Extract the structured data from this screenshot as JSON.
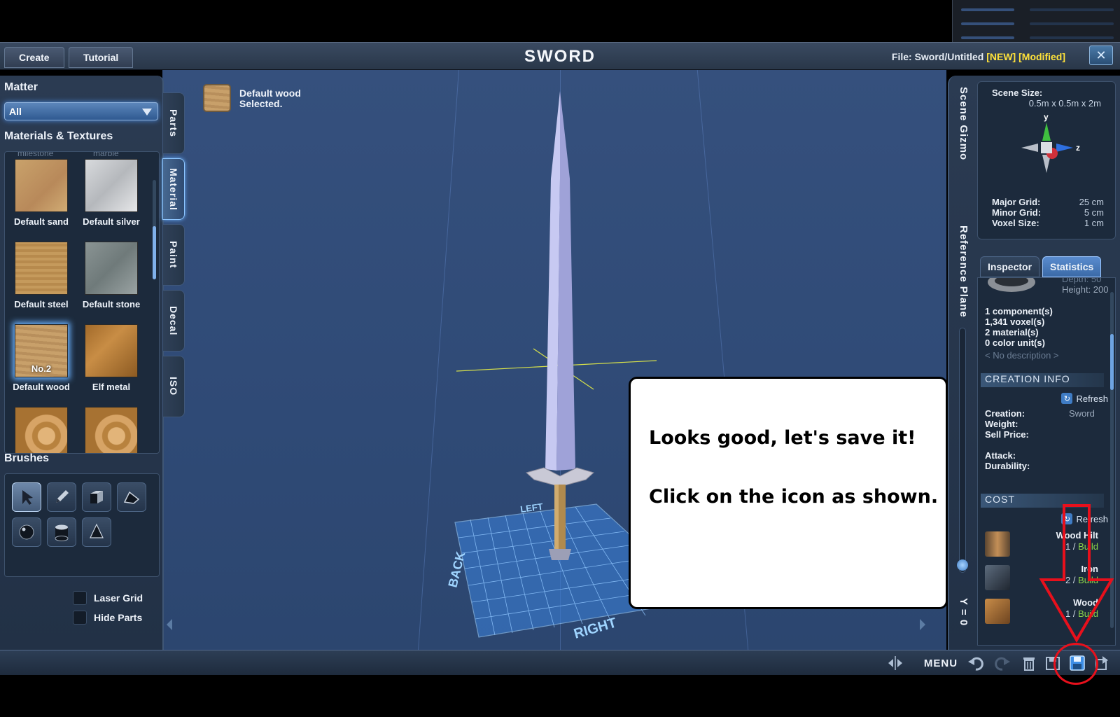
{
  "window": {
    "create_tab": "Create",
    "tutorial_tab": "Tutorial",
    "title": "SWORD",
    "file_label": "File:",
    "file_name": "Sword/Untitled",
    "tag_new": "[NEW]",
    "tag_modified": "[Modified]",
    "close_glyph": "✕"
  },
  "left_panel": {
    "matter_heading": "Matter",
    "matter_select": "All",
    "materials_heading": "Materials & Textures",
    "cutoff_labels": [
      "milestone",
      "marble"
    ],
    "materials": [
      {
        "label": "Default sand"
      },
      {
        "label": "Default silver"
      },
      {
        "label": "Default steel"
      },
      {
        "label": "Default stone"
      },
      {
        "label": "Default wood",
        "badge": "No.2",
        "selected": true
      },
      {
        "label": "Elf metal"
      }
    ],
    "brushes_heading": "Brushes",
    "brushes": [
      "select-arrow-icon",
      "pencil-icon",
      "cube-icon",
      "wedge-icon",
      "sphere-icon",
      "cylinder-icon",
      "cone-icon"
    ],
    "laser_grid_label": "Laser Grid",
    "hide_parts_label": "Hide Parts"
  },
  "side_tabs": [
    "Parts",
    "Material",
    "Paint",
    "Decal",
    "ISO"
  ],
  "selection": {
    "text": "Default wood\nSelected."
  },
  "viewport": {
    "grid_labels": [
      "LEFT",
      "BACK",
      "RIGHT"
    ]
  },
  "right_panel": {
    "scene_gizmo_label": "Scene Gizmo",
    "reference_plane_label": "Reference Plane",
    "y_label": "Y = 0",
    "scene_size_label": "Scene Size:",
    "scene_size_value": "0.5m x 0.5m x 2m",
    "axis_y": "y",
    "axis_z": "z",
    "major_grid_label": "Major Grid:",
    "major_grid_value": "25 cm",
    "minor_grid_label": "Minor Grid:",
    "minor_grid_value": "5 cm",
    "voxel_size_label": "Voxel Size:",
    "voxel_size_value": "1 cm",
    "tab_inspector": "Inspector",
    "tab_statistics": "Statistics",
    "depth_text": "Depth: 50",
    "height_text": "Height: 200",
    "components": "1 component(s)",
    "voxels": "1,341 voxel(s)",
    "materials": "2 material(s)",
    "color_units": "0 color unit(s)",
    "no_description": "< No description >",
    "creation_info_heading": "CREATION INFO",
    "refresh_label": "Refresh",
    "creation_label": "Creation:",
    "creation_value": "Sword",
    "weight_label": "Weight:",
    "sell_price_label": "Sell Price:",
    "attack_label": "Attack:",
    "durability_label": "Durability:",
    "cost_heading": "COST",
    "cost_refresh_label": "Refresh",
    "cost_items": [
      {
        "name": "Wood Hilt",
        "count": "1 /",
        "build": "Build"
      },
      {
        "name": "Iron",
        "count": "2 /",
        "build": "Build"
      },
      {
        "name": "Wood",
        "count": "1 /",
        "build": "Build"
      }
    ]
  },
  "bottom_bar": {
    "menu_label": "MENU"
  },
  "callout": {
    "line1": "Looks good, let's save it!",
    "line2": "Click on the icon as shown."
  },
  "colors": {
    "accent_blue": "#6bb2ff",
    "tag_yellow": "#ffe23a",
    "annotation_red": "#e8101c",
    "build_green": "#8bd34a"
  }
}
